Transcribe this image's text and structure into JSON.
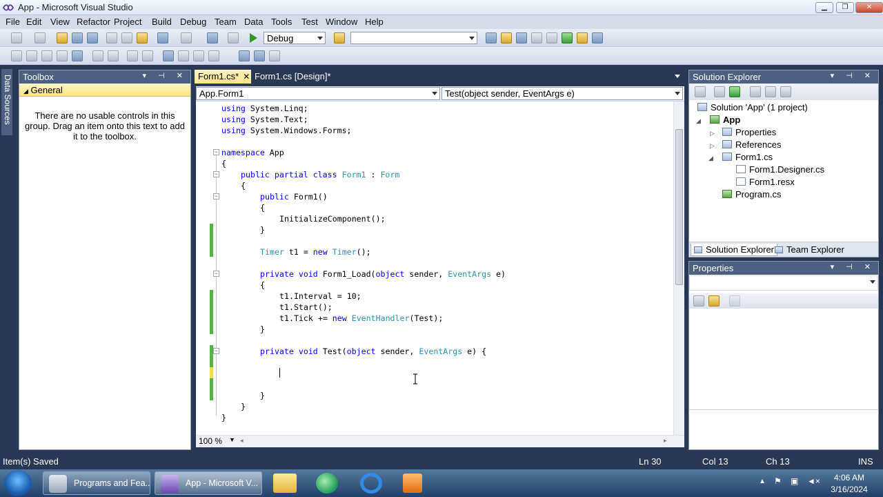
{
  "window": {
    "title": "App - Microsoft Visual Studio",
    "min_label": "▁",
    "max_label": "❐",
    "close_label": "✕"
  },
  "menu": [
    "File",
    "Edit",
    "View",
    "Refactor",
    "Project",
    "Build",
    "Debug",
    "Team",
    "Data",
    "Tools",
    "Test",
    "Window",
    "Help"
  ],
  "toolbar": {
    "config_value": "Debug",
    "platform_value": ""
  },
  "left_rail": {
    "data_sources_label": "Data Sources"
  },
  "toolbox": {
    "title": "Toolbox",
    "group_label": "General",
    "empty_message": "There are no usable controls in this group. Drag an item onto this text to add it to the toolbox."
  },
  "editor": {
    "tabs": [
      {
        "label": "Form1.cs*",
        "close": "✕"
      },
      {
        "label": "Form1.cs [Design]*"
      }
    ],
    "class_dropdown": "App.Form1",
    "member_dropdown": "Test(object sender, EventArgs e)",
    "zoom": "100 %"
  },
  "code": {
    "l1_kw": "using",
    "l1_rest": " System.Linq;",
    "l2_kw": "using",
    "l2_rest": " System.Text;",
    "l3_kw": "using",
    "l3_rest": " System.Windows.Forms;",
    "l5_kw": "namespace",
    "l5_rest": " App",
    "l6": "{",
    "l7_kw": "public partial class",
    "l7_ty": "Form1",
    "l7_mid": " : ",
    "l7_ty2": "Form",
    "l8": "{",
    "l9_kw": "public",
    "l9_rest": " Form1()",
    "l10": "{",
    "l11": "InitializeComponent();",
    "l12": "}",
    "l14_ty": "Timer",
    "l14_mid": " t1 = ",
    "l14_kw": "new",
    "l14_ty2": "Timer",
    "l14_end": "();",
    "l16_kw": "private void",
    "l16_a": " Form1_Load(",
    "l16_kw2": "object",
    "l16_b": " sender, ",
    "l16_ty": "EventArgs",
    "l16_c": " e)",
    "l17": "{",
    "l18": "t1.Interval = 10;",
    "l19": "t1.Start();",
    "l20_a": "t1.Tick += ",
    "l20_kw": "new",
    "l20_ty": "EventHandler",
    "l20_b": "(Test);",
    "l21": "}",
    "l23_kw": "private void",
    "l23_a": " Test(",
    "l23_kw2": "object",
    "l23_b": " sender, ",
    "l23_ty": "EventArgs",
    "l23_c": " e) {",
    "l26": "}",
    "l27": "}",
    "l28": "}"
  },
  "solution_explorer": {
    "title": "Solution Explorer",
    "solution": "Solution 'App' (1 project)",
    "project": "App",
    "items": [
      "Properties",
      "References",
      "Form1.cs",
      "Form1.Designer.cs",
      "Form1.resx",
      "Program.cs"
    ],
    "tab_solution": "Solution Explorer",
    "tab_team": "Team Explorer"
  },
  "properties": {
    "title": "Properties"
  },
  "status": {
    "message": "Item(s) Saved",
    "ln": "Ln 30",
    "col": "Col 13",
    "ch": "Ch 13",
    "mode": "INS"
  },
  "taskbar": {
    "tasks": [
      "Programs and Fea...",
      "App - Microsoft V..."
    ],
    "time": "4:06 AM",
    "date": "3/16/2024"
  }
}
